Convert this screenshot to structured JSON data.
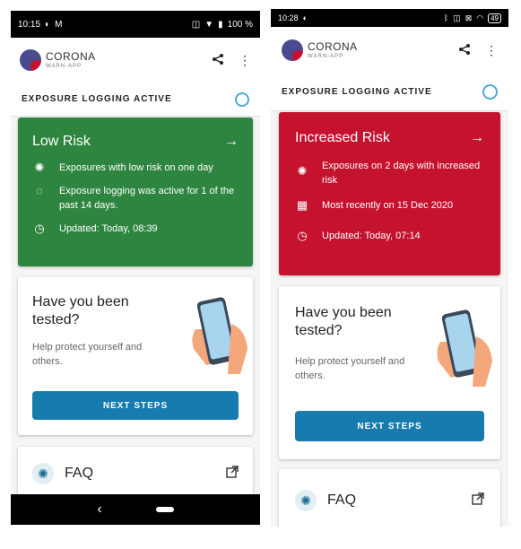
{
  "left": {
    "status": {
      "time": "10:15",
      "battery": "100 %"
    },
    "exposure_label": "EXPOSURE LOGGING ACTIVE",
    "risk": {
      "title": "Low Risk",
      "color": "#2e8540",
      "rows": [
        {
          "icon": "virus-icon",
          "text": "Exposures with low risk on one day"
        },
        {
          "icon": "progress-icon",
          "text": "Exposure logging was active for 1 of the past 14 days."
        },
        {
          "icon": "clock-icon",
          "text": "Updated: Today, 08:39"
        }
      ]
    },
    "tested": {
      "title": "Have you been tested?",
      "text": "Help protect yourself and others.",
      "button": "NEXT STEPS"
    },
    "faq": "FAQ"
  },
  "right": {
    "status": {
      "time": "10:28",
      "battery": "49"
    },
    "exposure_label": "EXPOSURE LOGGING ACTIVE",
    "risk": {
      "title": "Increased Risk",
      "color": "#c4122f",
      "rows": [
        {
          "icon": "virus-icon",
          "text": "Exposures on 2 days with increased risk"
        },
        {
          "icon": "calendar-icon",
          "text": "Most recently on 15 Dec 2020"
        },
        {
          "icon": "clock-icon",
          "text": "Updated: Today, 07:14"
        }
      ]
    },
    "tested": {
      "title": "Have you been tested?",
      "text": "Help protect yourself and others.",
      "button": "NEXT STEPS"
    },
    "faq": "FAQ"
  },
  "logo": {
    "title": "CORONA",
    "subtitle": "WARN-APP"
  },
  "colors": {
    "accent": "#177cad",
    "low_risk": "#2e8540",
    "high_risk": "#c4122f"
  }
}
